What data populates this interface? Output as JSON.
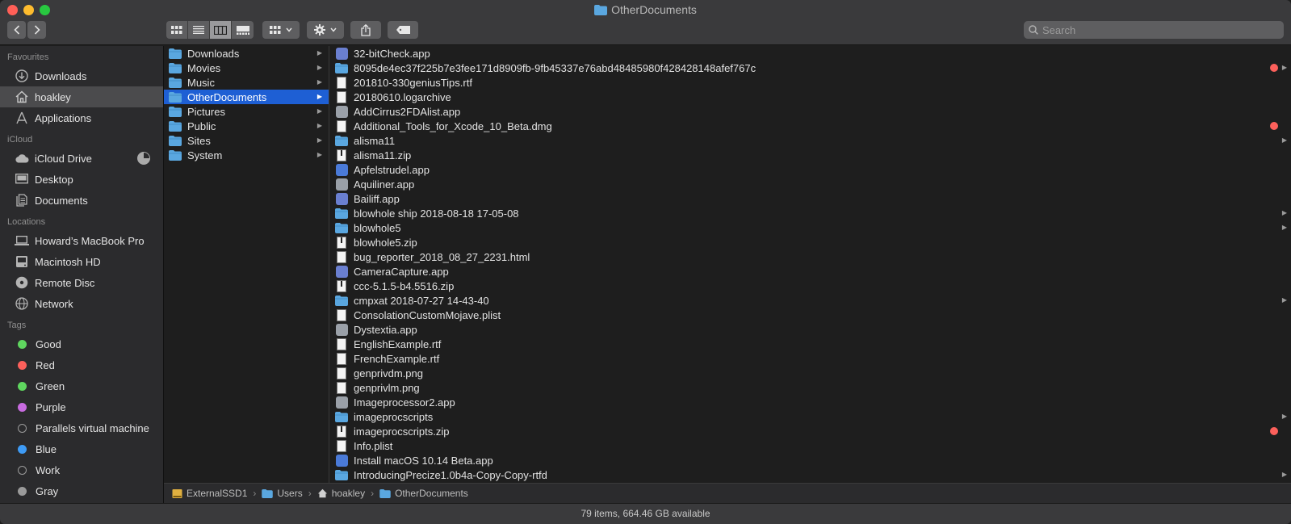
{
  "window": {
    "title": "OtherDocuments"
  },
  "toolbar": {
    "back": "<",
    "forward": ">",
    "search_placeholder": "Search"
  },
  "sidebar": {
    "favourites_header": "Favourites",
    "favourites": [
      {
        "label": "Downloads",
        "icon": "downloads-icon"
      },
      {
        "label": "hoakley",
        "icon": "home-icon",
        "selected": true
      },
      {
        "label": "Applications",
        "icon": "applications-icon"
      }
    ],
    "icloud_header": "iCloud",
    "icloud": [
      {
        "label": "iCloud Drive",
        "icon": "cloud-icon"
      },
      {
        "label": "Desktop",
        "icon": "desktop-icon"
      },
      {
        "label": "Documents",
        "icon": "documents-icon"
      }
    ],
    "locations_header": "Locations",
    "locations": [
      {
        "label": "Howard’s MacBook Pro",
        "icon": "laptop-icon"
      },
      {
        "label": "Macintosh HD",
        "icon": "hard-drive-icon"
      },
      {
        "label": "Remote Disc",
        "icon": "disc-icon"
      },
      {
        "label": "Network",
        "icon": "network-icon"
      }
    ],
    "tags_header": "Tags",
    "tags": [
      {
        "label": "Good",
        "color": "#5fd65f"
      },
      {
        "label": "Red",
        "color": "#fc605b"
      },
      {
        "label": "Green",
        "color": "#5fd65f"
      },
      {
        "label": "Purple",
        "color": "#c86be0"
      },
      {
        "label": "Parallels virtual machine",
        "color": ""
      },
      {
        "label": "Blue",
        "color": "#3e9bf5"
      },
      {
        "label": "Work",
        "color": ""
      },
      {
        "label": "Gray",
        "color": "#9a9a9a"
      }
    ]
  },
  "column1": {
    "items": [
      {
        "label": "Downloads",
        "selected": false
      },
      {
        "label": "Movies",
        "selected": false
      },
      {
        "label": "Music",
        "selected": false
      },
      {
        "label": "OtherDocuments",
        "selected": true
      },
      {
        "label": "Pictures",
        "selected": false
      },
      {
        "label": "Public",
        "selected": false
      },
      {
        "label": "Sites",
        "selected": false
      },
      {
        "label": "System",
        "selected": false
      }
    ]
  },
  "column2": {
    "items": [
      {
        "label": "32-bitCheck.app",
        "kind": "app",
        "folder": false,
        "red": false
      },
      {
        "label": "8095de4ec37f225b7e3fee171d8909fb-9fb45337e76abd48485980f428428148afef767c",
        "kind": "folder",
        "folder": true,
        "red": true
      },
      {
        "label": "201810-330geniusTips.rtf",
        "kind": "doc",
        "folder": false,
        "red": false
      },
      {
        "label": "20180610.logarchive",
        "kind": "doc",
        "folder": false,
        "red": false
      },
      {
        "label": "AddCirrus2FDAlist.app",
        "kind": "app",
        "folder": false,
        "red": false
      },
      {
        "label": "Additional_Tools_for_Xcode_10_Beta.dmg",
        "kind": "doc",
        "folder": false,
        "red": true
      },
      {
        "label": "alisma11",
        "kind": "folder",
        "folder": true,
        "red": false
      },
      {
        "label": "alisma11.zip",
        "kind": "zip",
        "folder": false,
        "red": false
      },
      {
        "label": "Apfelstrudel.app",
        "kind": "app",
        "folder": false,
        "red": false
      },
      {
        "label": "Aquiliner.app",
        "kind": "app",
        "folder": false,
        "red": false
      },
      {
        "label": "Bailiff.app",
        "kind": "app",
        "folder": false,
        "red": false
      },
      {
        "label": "blowhole ship 2018-08-18 17-05-08",
        "kind": "folder",
        "folder": true,
        "red": false
      },
      {
        "label": "blowhole5",
        "kind": "folder",
        "folder": true,
        "red": false
      },
      {
        "label": "blowhole5.zip",
        "kind": "zip",
        "folder": false,
        "red": false
      },
      {
        "label": "bug_reporter_2018_08_27_2231.html",
        "kind": "doc",
        "folder": false,
        "red": false
      },
      {
        "label": "CameraCapture.app",
        "kind": "app",
        "folder": false,
        "red": false
      },
      {
        "label": "ccc-5.1.5-b4.5516.zip",
        "kind": "zip",
        "folder": false,
        "red": false
      },
      {
        "label": "cmpxat 2018-07-27 14-43-40",
        "kind": "folder",
        "folder": true,
        "red": false
      },
      {
        "label": "ConsolationCustomMojave.plist",
        "kind": "doc",
        "folder": false,
        "red": false
      },
      {
        "label": "Dystextia.app",
        "kind": "app",
        "folder": false,
        "red": false
      },
      {
        "label": "EnglishExample.rtf",
        "kind": "doc",
        "folder": false,
        "red": false
      },
      {
        "label": "FrenchExample.rtf",
        "kind": "doc",
        "folder": false,
        "red": false
      },
      {
        "label": "genprivdm.png",
        "kind": "doc",
        "folder": false,
        "red": false
      },
      {
        "label": "genprivlm.png",
        "kind": "doc",
        "folder": false,
        "red": false
      },
      {
        "label": "Imageprocessor2.app",
        "kind": "app",
        "folder": false,
        "red": false
      },
      {
        "label": "imageprocscripts",
        "kind": "folder",
        "folder": true,
        "red": false
      },
      {
        "label": "imageprocscripts.zip",
        "kind": "zip",
        "folder": false,
        "red": true
      },
      {
        "label": "Info.plist",
        "kind": "doc",
        "folder": false,
        "red": false
      },
      {
        "label": "Install macOS 10.14 Beta.app",
        "kind": "app",
        "folder": false,
        "red": false
      },
      {
        "label": "IntroducingPrecize1.0b4a-Copy-Copy-rtfd",
        "kind": "folder",
        "folder": true,
        "red": false
      }
    ]
  },
  "pathbar": [
    "ExternalSSD1",
    "Users",
    "hoakley",
    "OtherDocuments"
  ],
  "status": {
    "text": "79 items, 664.46 GB available"
  },
  "colors": {
    "selection": "#1e5fd4",
    "folder": "#5aa7e0",
    "tag_red": "#fc605b"
  }
}
